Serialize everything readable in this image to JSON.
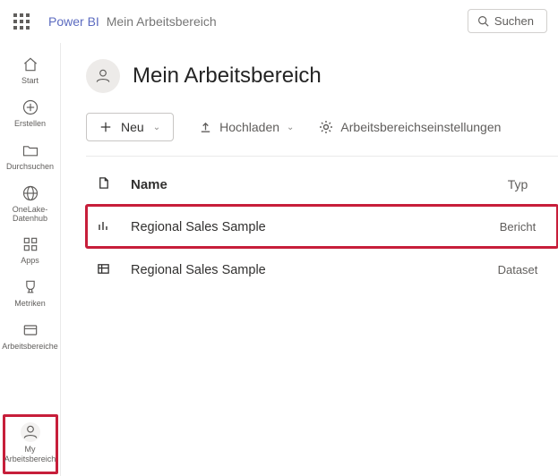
{
  "topbar": {
    "brand": "Power BI",
    "breadcrumb": "Mein Arbeitsbereich",
    "search_label": "Suchen"
  },
  "rail": {
    "items": [
      {
        "label": "Start"
      },
      {
        "label": "Erstellen"
      },
      {
        "label": "Durchsuchen"
      },
      {
        "label": "OneLake-Datenhub"
      },
      {
        "label": "Apps"
      },
      {
        "label": "Metriken"
      },
      {
        "label": "Arbeitsbereiche"
      }
    ],
    "my": {
      "line1": "My",
      "line2": "Arbeitsbereich"
    }
  },
  "workspace": {
    "title": "Mein Arbeitsbereich",
    "toolbar": {
      "new_label": "Neu",
      "upload_label": "Hochladen",
      "settings_label": "Arbeitsbereichseinstellungen"
    }
  },
  "table": {
    "col_name": "Name",
    "col_type": "Typ",
    "rows": [
      {
        "name": "Regional Sales Sample",
        "type": "Bericht"
      },
      {
        "name": "Regional Sales Sample",
        "type": "Dataset"
      }
    ]
  }
}
